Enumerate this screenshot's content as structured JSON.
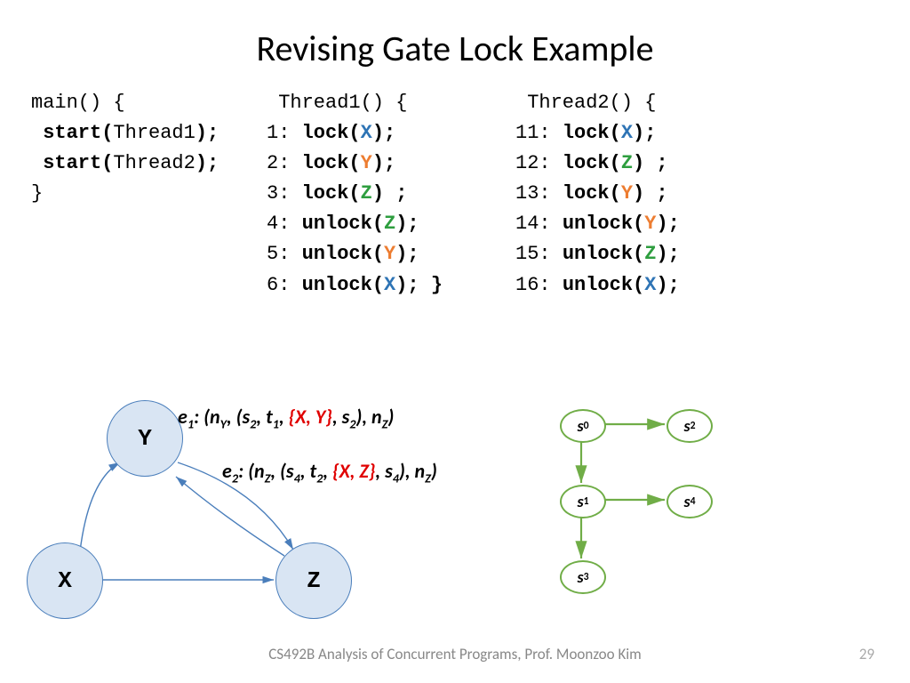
{
  "title": "Revising Gate Lock Example",
  "code": {
    "main": {
      "header": "main() {",
      "lines": [
        "start(Thread1);",
        "start(Thread2);"
      ],
      "close": "}"
    },
    "t1": {
      "header": "Thread1() {",
      "lines": [
        {
          "n": "1:",
          "fn": "lock(",
          "v": "X",
          "tail": ");"
        },
        {
          "n": "2:",
          "fn": " lock(",
          "v": "Y",
          "tail": ");"
        },
        {
          "n": "3:",
          "fn": "  lock(",
          "v": "Z",
          "tail": ") ;"
        },
        {
          "n": "4:",
          "fn": "  unlock(",
          "v": "Z",
          "tail": ");"
        },
        {
          "n": "5:",
          "fn": " unlock(",
          "v": "Y",
          "tail": ");"
        },
        {
          "n": "6:",
          "fn": "unlock(",
          "v": "X",
          "tail": "); }"
        }
      ]
    },
    "t2": {
      "header": "Thread2() {",
      "lines": [
        {
          "n": "11:",
          "fn": "lock(",
          "v": "X",
          "tail": ");"
        },
        {
          "n": "12:",
          "fn": " lock(",
          "v": "Z",
          "tail": ") ;"
        },
        {
          "n": "13:",
          "fn": "  lock(",
          "v": "Y",
          "tail": ") ;"
        },
        {
          "n": "14:",
          "fn": "  unlock(",
          "v": "Y",
          "tail": ");"
        },
        {
          "n": "15:",
          "fn": " unlock(",
          "v": "Z",
          "tail": ");"
        },
        {
          "n": "16:",
          "fn": "unlock(",
          "v": "X",
          "tail": ");"
        }
      ]
    }
  },
  "graph": {
    "nodes": [
      "Y",
      "X",
      "Z"
    ],
    "edges": [
      {
        "label": "e1",
        "tuple_prefix": ": (n",
        "a": "Y",
        "mid1": ", (s",
        "s1": "2",
        "mid2": ", t",
        "t": "1",
        "mid3": ", ",
        "set": "{X, Y}",
        "mid4": ", s",
        "s2": "2",
        "mid5": "), n",
        "b": "Z",
        "end": ")"
      },
      {
        "label": "e2",
        "tuple_prefix": ": (n",
        "a": "Z",
        "mid1": ", (s",
        "s1": "4",
        "mid2": ", t",
        "t": "2",
        "mid3": ", ",
        "set": "{X, Z}",
        "mid4": ", s",
        "s2": "4",
        "mid5": "), n",
        "b": "Z",
        "end": ")"
      }
    ]
  },
  "states": {
    "nodes": [
      "s0",
      "s2",
      "s1",
      "s4",
      "s3"
    ],
    "edges": [
      [
        "s0",
        "s2"
      ],
      [
        "s0",
        "s1"
      ],
      [
        "s1",
        "s4"
      ],
      [
        "s1",
        "s3"
      ]
    ]
  },
  "footer": "CS492B Analysis of Concurrent Programs, Prof. Moonzoo Kim",
  "page": "29"
}
